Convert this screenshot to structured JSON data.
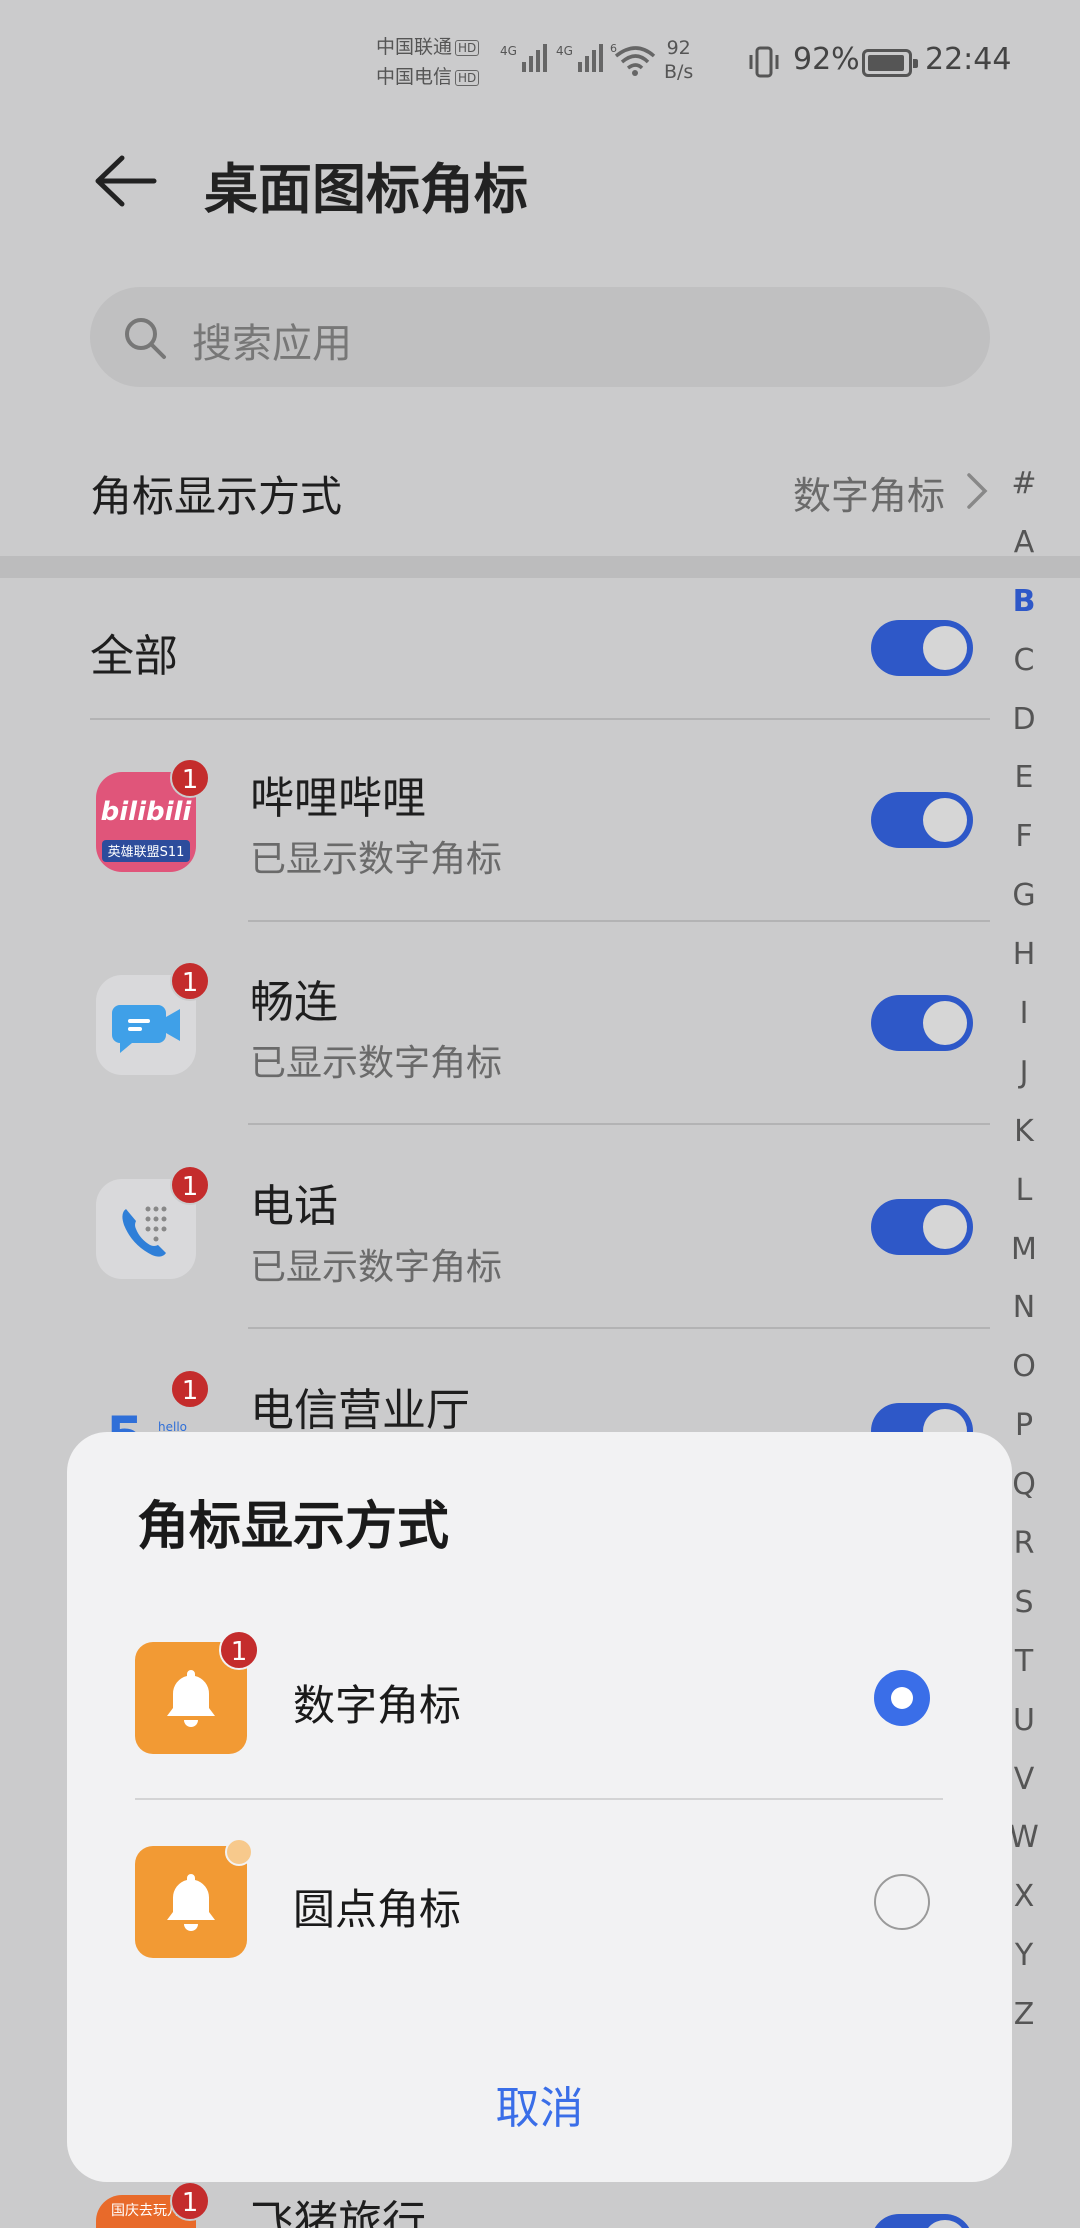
{
  "status_bar": {
    "carrier1": "中国联通",
    "carrier2": "中国电信",
    "hd": "HD",
    "sig1_label": "4G",
    "sig2_label": "4G",
    "wifi_label": "6",
    "speed_value": "92",
    "speed_unit": "B/s",
    "battery_percent": "92%",
    "time": "22:44"
  },
  "header": {
    "title": "桌面图标角标"
  },
  "search": {
    "placeholder": "搜索应用"
  },
  "badge_mode": {
    "label": "角标显示方式",
    "value": "数字角标"
  },
  "all_toggle": {
    "label": "全部",
    "on": true
  },
  "apps": [
    {
      "name": "哔哩哔哩",
      "status": "已显示数字角标",
      "badge": "1",
      "on": true
    },
    {
      "name": "畅连",
      "status": "已显示数字角标",
      "badge": "1",
      "on": true
    },
    {
      "name": "电话",
      "status": "已显示数字角标",
      "badge": "1",
      "on": true
    },
    {
      "name": "电信营业厅",
      "badge": "1",
      "on": true
    },
    {
      "name": "飞猪旅行",
      "badge": "1",
      "on": true
    }
  ],
  "icon_text": {
    "bilibili": "bilibili",
    "bilibili_sub": "英雄联盟S11",
    "telecom_sub": "hello",
    "fliggy_sub": "国庆去玩儿"
  },
  "alphabet": [
    "#",
    "A",
    "B",
    "C",
    "D",
    "E",
    "F",
    "G",
    "H",
    "I",
    "J",
    "K",
    "L",
    "M",
    "N",
    "O",
    "P",
    "Q",
    "R",
    "S",
    "T",
    "U",
    "V",
    "W",
    "X",
    "Y",
    "Z"
  ],
  "alphabet_active": "B",
  "dialog": {
    "title": "角标显示方式",
    "options": [
      {
        "label": "数字角标",
        "badge": "1",
        "selected": true
      },
      {
        "label": "圆点角标",
        "selected": false
      }
    ],
    "cancel": "取消"
  },
  "colors": {
    "accent": "#2e58c8",
    "badge": "#c42c2c",
    "option_icon": "#f29a34"
  }
}
